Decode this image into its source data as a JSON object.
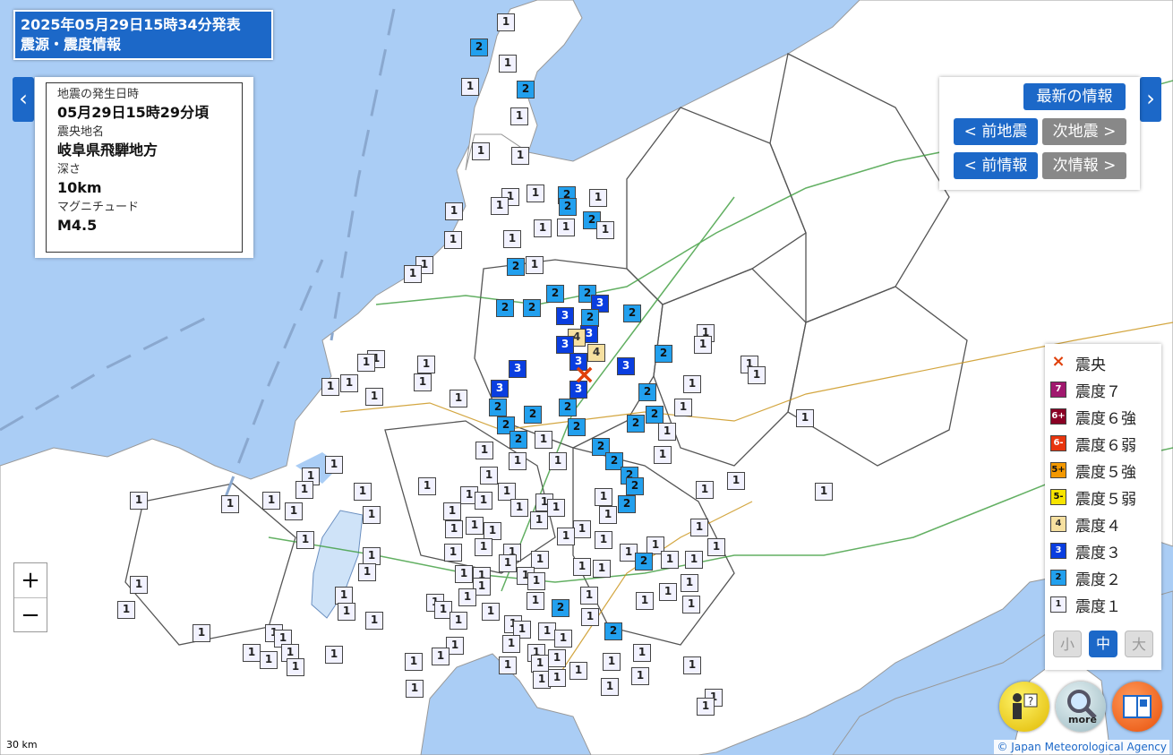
{
  "header": {
    "issue_time": "2025年05月29日15時34分発表",
    "product_title": "震源・震度情報"
  },
  "quake_info": {
    "origin_time_label": "地震の発生日時",
    "origin_time": "05月29日15時29分頃",
    "region_label": "震央地名",
    "region": "岐阜県飛騨地方",
    "depth_label": "深さ",
    "depth": "10km",
    "magnitude_label": "マグニチュード",
    "magnitude": "M4.5"
  },
  "nav": {
    "latest": "最新の情報",
    "prev_quake": "< 前地震",
    "next_quake": "次地震 >",
    "prev_info": "< 前情報",
    "next_info": "次情報 >"
  },
  "legend": {
    "items": [
      {
        "label": "震央",
        "swatch": "×",
        "color": "#e0400a"
      },
      {
        "label": "震度７",
        "swatch": "7",
        "color": "#a0186e"
      },
      {
        "label": "震度６強",
        "swatch": "6+",
        "color": "#8a0024"
      },
      {
        "label": "震度６弱",
        "swatch": "6-",
        "color": "#e8350e"
      },
      {
        "label": "震度５強",
        "swatch": "5+",
        "color": "#f39800"
      },
      {
        "label": "震度５弱",
        "swatch": "5-",
        "color": "#f7e400"
      },
      {
        "label": "震度４",
        "swatch": "4",
        "color": "#f6e0a0"
      },
      {
        "label": "震度３",
        "swatch": "3",
        "color": "#0a3ee0"
      },
      {
        "label": "震度２",
        "swatch": "2",
        "color": "#22a0ee"
      },
      {
        "label": "震度１",
        "swatch": "1",
        "color": "#f2f2ff"
      }
    ],
    "size_small": "小",
    "size_medium": "中",
    "size_large": "大"
  },
  "zoom": {
    "in": "+",
    "out": "−"
  },
  "scale": "30 km",
  "attribution": "© Japan Meteorological Agency",
  "more_label": "more",
  "epicenter_marker": "×"
}
